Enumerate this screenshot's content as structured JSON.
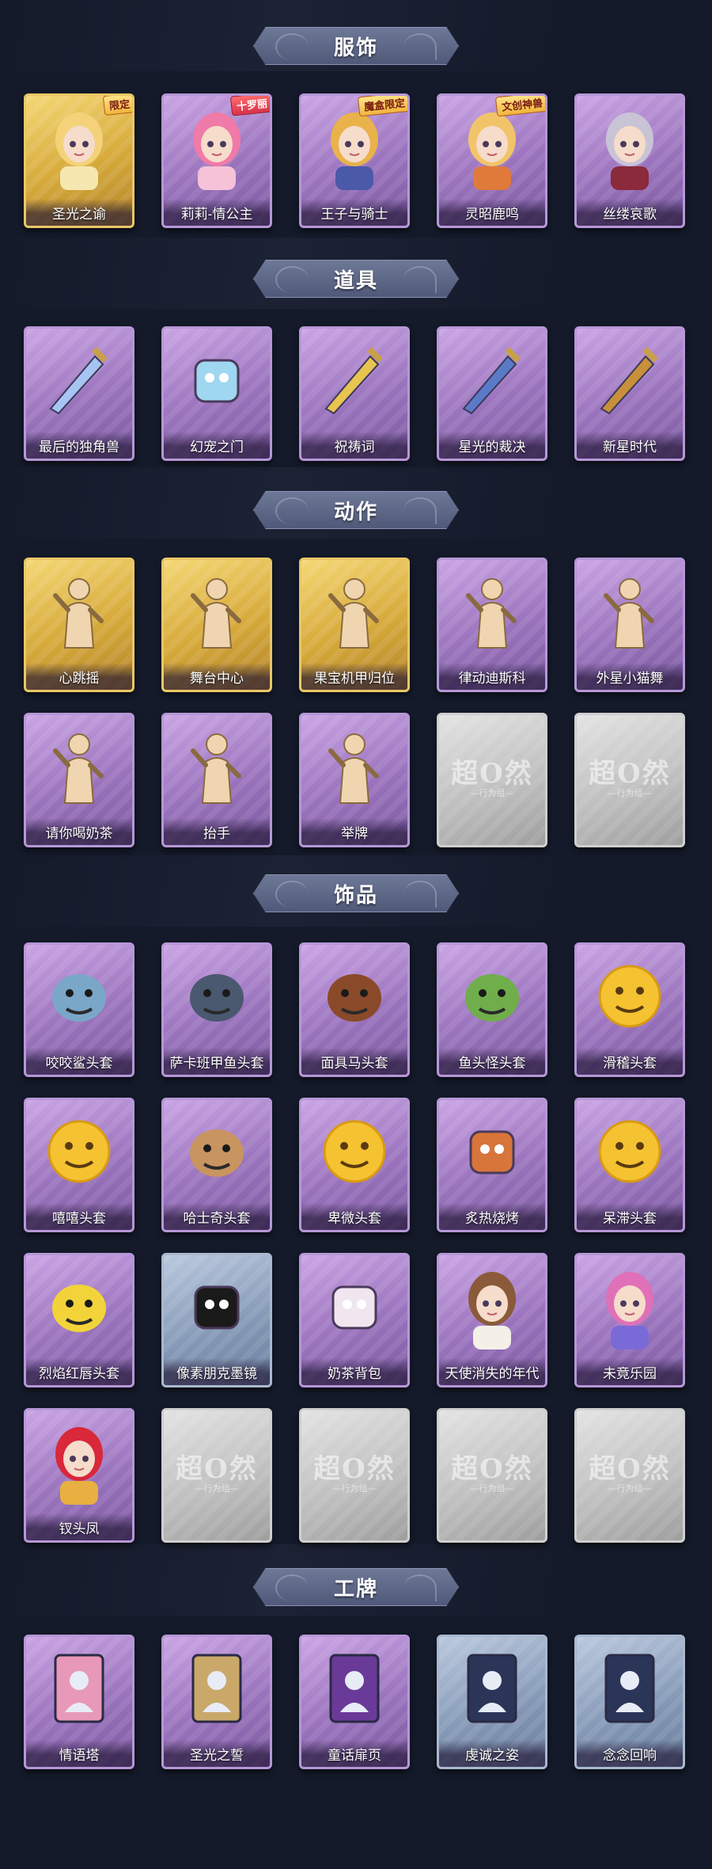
{
  "sections": [
    {
      "title": "服饰",
      "items": [
        {
          "label": "圣光之谕",
          "style": "gold",
          "icon": "blonde-princess-portrait",
          "badge": "限定"
        },
        {
          "label": "莉莉-情公主",
          "style": "purple",
          "icon": "pink-hair-girl-portrait",
          "badge": "十罗丽"
        },
        {
          "label": "王子与骑士",
          "style": "purple",
          "icon": "prince-portrait",
          "badge": "魔盒限定"
        },
        {
          "label": "灵昭鹿鸣",
          "style": "purple",
          "icon": "deer-spirit-portrait",
          "badge": "文创神兽"
        },
        {
          "label": "丝缕哀歌",
          "style": "purple",
          "icon": "gothic-doll-portrait",
          "badge": ""
        }
      ]
    },
    {
      "title": "道具",
      "items": [
        {
          "label": "最后的独角兽",
          "style": "purple",
          "icon": "unicorn-sword-icon"
        },
        {
          "label": "幻宠之门",
          "style": "purple",
          "icon": "pet-device-icon"
        },
        {
          "label": "祝祷词",
          "style": "purple",
          "icon": "cross-pendant-icon"
        },
        {
          "label": "星光的裁决",
          "style": "purple",
          "icon": "starlight-gun-icon"
        },
        {
          "label": "新星时代",
          "style": "purple",
          "icon": "revolver-icon"
        }
      ]
    },
    {
      "title": "动作",
      "items": [
        {
          "label": "心跳摇",
          "style": "gold",
          "icon": "dance-pose-icon"
        },
        {
          "label": "舞台中心",
          "style": "gold",
          "icon": "stage-pose-icon"
        },
        {
          "label": "果宝机甲归位",
          "style": "gold",
          "icon": "mecha-pose-icon"
        },
        {
          "label": "律动迪斯科",
          "style": "purple",
          "icon": "disco-pose-icon"
        },
        {
          "label": "外星小猫舞",
          "style": "purple",
          "icon": "cat-dance-pose-icon"
        },
        {
          "label": "请你喝奶茶",
          "style": "purple",
          "icon": "milk-tea-pose-icon"
        },
        {
          "label": "抬手",
          "style": "purple",
          "icon": "raise-hand-pose-icon"
        },
        {
          "label": "举牌",
          "style": "purple",
          "icon": "hold-sign-pose-icon"
        },
        {
          "label": "",
          "style": "grey",
          "icon": "placeholder-logo",
          "watermark": "超O然",
          "watermark_sub": "—行为组—"
        },
        {
          "label": "",
          "style": "grey",
          "icon": "placeholder-logo",
          "watermark": "超O然",
          "watermark_sub": "—行为组—"
        }
      ]
    },
    {
      "title": "饰品",
      "items": [
        {
          "label": "咬咬鲨头套",
          "style": "purple",
          "icon": "shark-head-icon"
        },
        {
          "label": "萨卡班甲鱼头套",
          "style": "purple",
          "icon": "fish-head-icon"
        },
        {
          "label": "面具马头套",
          "style": "purple",
          "icon": "horse-head-icon"
        },
        {
          "label": "鱼头怪头套",
          "style": "purple",
          "icon": "fish-monster-head-icon"
        },
        {
          "label": "滑稽头套",
          "style": "purple",
          "icon": "smirk-emoji-icon"
        },
        {
          "label": "嘻嘻头套",
          "style": "purple",
          "icon": "grin-emoji-icon"
        },
        {
          "label": "哈士奇头套",
          "style": "purple",
          "icon": "husky-head-icon"
        },
        {
          "label": "卑微头套",
          "style": "purple",
          "icon": "shy-emoji-icon"
        },
        {
          "label": "炙热烧烤",
          "style": "purple",
          "icon": "bbq-meat-icon"
        },
        {
          "label": "呆滞头套",
          "style": "purple",
          "icon": "dazed-emoji-icon"
        },
        {
          "label": "烈焰红唇头套",
          "style": "purple",
          "icon": "red-lips-mask-icon"
        },
        {
          "label": "像素朋克墨镜",
          "style": "blue",
          "icon": "pixel-sunglasses-icon"
        },
        {
          "label": "奶茶背包",
          "style": "purple",
          "icon": "milk-tea-bag-icon"
        },
        {
          "label": "天使消失的年代",
          "style": "purple",
          "icon": "angel-doll-icon"
        },
        {
          "label": "未竟乐园",
          "style": "purple",
          "icon": "paradise-doll-icon"
        },
        {
          "label": "钗头凤",
          "style": "purple",
          "icon": "phoenix-crown-icon"
        },
        {
          "label": "",
          "style": "grey",
          "icon": "placeholder-logo",
          "watermark": "超O然",
          "watermark_sub": "—行为组—"
        },
        {
          "label": "",
          "style": "grey",
          "icon": "placeholder-logo",
          "watermark": "超O然",
          "watermark_sub": "—行为组—"
        },
        {
          "label": "",
          "style": "grey",
          "icon": "placeholder-logo",
          "watermark": "超O然",
          "watermark_sub": "—行为组—"
        },
        {
          "label": "",
          "style": "grey",
          "icon": "placeholder-logo",
          "watermark": "超O然",
          "watermark_sub": "—行为组—"
        }
      ]
    },
    {
      "title": "工牌",
      "items": [
        {
          "label": "情语塔",
          "style": "purple",
          "icon": "tower-card-icon"
        },
        {
          "label": "圣光之誓",
          "style": "purple",
          "icon": "holy-card-icon"
        },
        {
          "label": "童话扉页",
          "style": "purple",
          "icon": "storybook-card-icon"
        },
        {
          "label": "虔诚之姿",
          "style": "blue",
          "icon": "silhouette-card-icon"
        },
        {
          "label": "念念回响",
          "style": "blue",
          "icon": "silhouette-card-icon"
        }
      ]
    }
  ]
}
